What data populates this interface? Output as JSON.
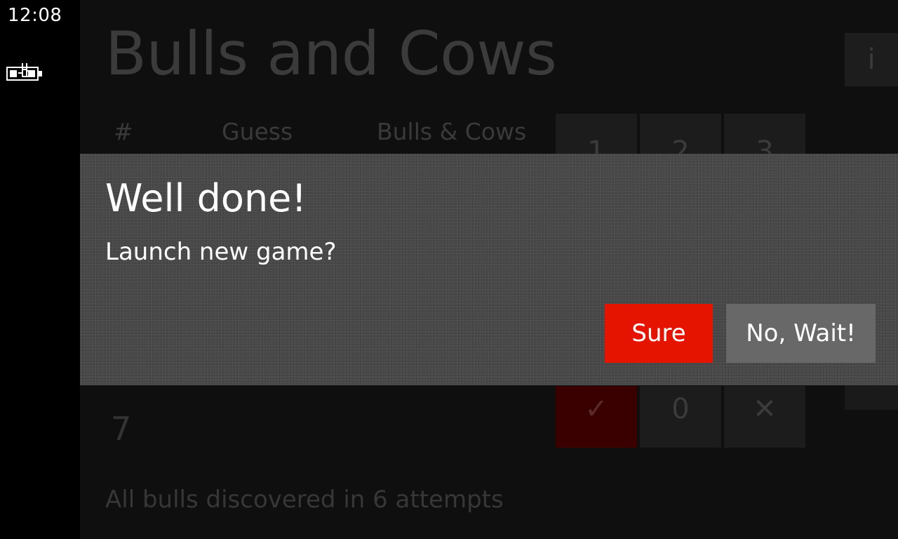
{
  "status_bar": {
    "time": "12:08",
    "battery_icon": "battery-charging-icon"
  },
  "app": {
    "title": "Bulls and Cows",
    "info_button": "i",
    "columns": {
      "number": "#",
      "guess": "Guess",
      "bulls_cows": "Bulls & Cows"
    },
    "keypad": {
      "top_row": [
        "1",
        "2",
        "3"
      ],
      "bottom_row": {
        "ok": "✓",
        "zero": "0",
        "clear": "✕"
      }
    },
    "attempt_number": "7",
    "summary": "All bulls discovered in 6 attempts"
  },
  "dialog": {
    "title": "Well done!",
    "message": "Launch new game?",
    "confirm_label": "Sure",
    "cancel_label": "No, Wait!"
  },
  "colors": {
    "accent": "#e51400",
    "dialog_background": "#484848",
    "secondary_button": "#686868"
  }
}
